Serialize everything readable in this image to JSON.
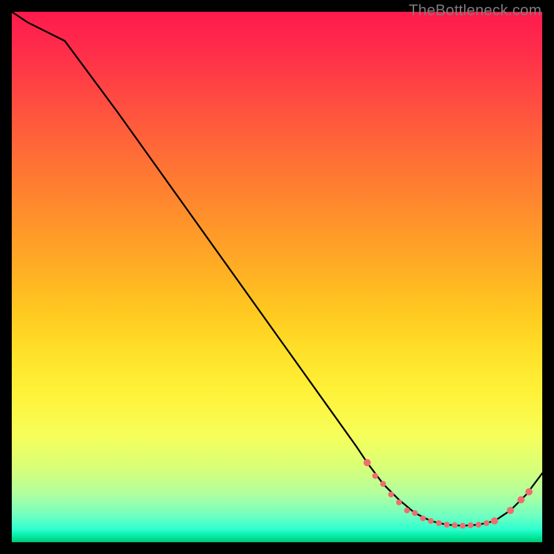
{
  "watermark": "TheBottleneck.com",
  "chart_data": {
    "type": "line",
    "title": "",
    "xlabel": "",
    "ylabel": "",
    "xlim": [
      0,
      100
    ],
    "ylim": [
      0,
      100
    ],
    "grid": false,
    "series": [
      {
        "name": "curve",
        "color": "#000000",
        "x": [
          0,
          3,
          6,
          10,
          20,
          30,
          40,
          50,
          60,
          65,
          67,
          70,
          73,
          76,
          79,
          82,
          85,
          88,
          91,
          94,
          97,
          100
        ],
        "y": [
          100,
          98,
          96.5,
          94.5,
          81,
          67,
          53,
          39,
          25,
          18,
          15,
          11,
          8,
          5.5,
          4,
          3.3,
          3.1,
          3.3,
          4,
          6,
          9,
          13
        ]
      }
    ],
    "markers": {
      "name": "highlight",
      "color": "#ef6e6e",
      "radius_small": 4.2,
      "radius_large": 5.2,
      "points": [
        {
          "x": 67,
          "y": 15,
          "r": "large"
        },
        {
          "x": 68.5,
          "y": 12.5,
          "r": "small"
        },
        {
          "x": 70,
          "y": 11,
          "r": "small"
        },
        {
          "x": 71.5,
          "y": 9,
          "r": "small"
        },
        {
          "x": 73,
          "y": 7.5,
          "r": "small"
        },
        {
          "x": 74.5,
          "y": 6,
          "r": "small"
        },
        {
          "x": 76,
          "y": 5.5,
          "r": "small"
        },
        {
          "x": 77.5,
          "y": 4.5,
          "r": "small"
        },
        {
          "x": 79,
          "y": 4,
          "r": "small"
        },
        {
          "x": 80.5,
          "y": 3.6,
          "r": "small"
        },
        {
          "x": 82,
          "y": 3.3,
          "r": "small"
        },
        {
          "x": 83.5,
          "y": 3.2,
          "r": "small"
        },
        {
          "x": 85,
          "y": 3.1,
          "r": "small"
        },
        {
          "x": 86.5,
          "y": 3.2,
          "r": "small"
        },
        {
          "x": 88,
          "y": 3.3,
          "r": "small"
        },
        {
          "x": 89.5,
          "y": 3.6,
          "r": "small"
        },
        {
          "x": 91,
          "y": 4,
          "r": "large"
        },
        {
          "x": 94,
          "y": 6,
          "r": "large"
        },
        {
          "x": 96,
          "y": 8,
          "r": "large"
        },
        {
          "x": 97.5,
          "y": 9.5,
          "r": "large"
        }
      ]
    }
  }
}
